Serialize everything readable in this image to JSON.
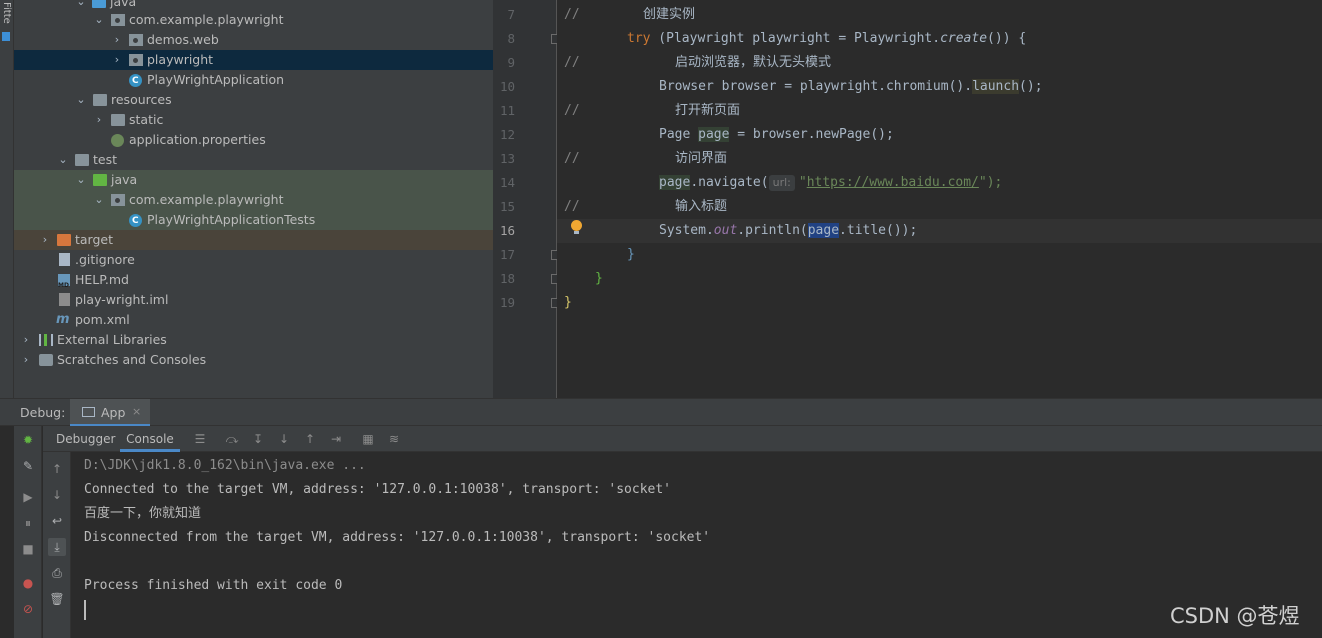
{
  "left_strip": {
    "vertical_tab_label": "Fitte"
  },
  "project_tree": {
    "rows": [
      {
        "label": "java",
        "icon": "source-folder-icon"
      },
      {
        "label": "com.example.playwright",
        "icon": "package-icon"
      },
      {
        "label": "demos.web",
        "icon": "package-icon"
      },
      {
        "label": "playwright",
        "icon": "package-icon",
        "selected": true
      },
      {
        "label": "PlayWrightApplication",
        "icon": "spring-class-icon"
      },
      {
        "label": "resources",
        "icon": "resources-folder-icon"
      },
      {
        "label": "static",
        "icon": "folder-icon"
      },
      {
        "label": "application.properties",
        "icon": "properties-file-icon"
      },
      {
        "label": "test",
        "icon": "folder-icon"
      },
      {
        "label": "java",
        "icon": "test-source-folder-icon"
      },
      {
        "label": "com.example.playwright",
        "icon": "package-icon"
      },
      {
        "label": "PlayWrightApplicationTests",
        "icon": "test-class-icon"
      },
      {
        "label": "target",
        "icon": "excluded-folder-icon"
      },
      {
        "label": ".gitignore",
        "icon": "gitignore-file-icon"
      },
      {
        "label": "HELP.md",
        "icon": "markdown-file-icon"
      },
      {
        "label": "play-wright.iml",
        "icon": "iml-file-icon"
      },
      {
        "label": "pom.xml",
        "icon": "maven-pom-icon"
      },
      {
        "label": "External Libraries",
        "icon": "libraries-icon"
      },
      {
        "label": "Scratches and Consoles",
        "icon": "scratches-icon"
      }
    ]
  },
  "editor": {
    "line_numbers": [
      "7",
      "8",
      "9",
      "10",
      "11",
      "12",
      "13",
      "14",
      "15",
      "16",
      "17",
      "18",
      "19"
    ],
    "current_line": "16",
    "code": {
      "l7_comment_marker": "//",
      "l7_comment_text": "创建实例",
      "l8_try": "try",
      "l8_rest": " (Playwright playwright = Playwright.",
      "l8_create": "create",
      "l8_tail": "()) {",
      "l9_comment_marker": "//",
      "l9_comment_text": "启动浏览器，默认无头模式",
      "l10_start": "Browser browser = playwright.chromium().",
      "l10_launch": "launch",
      "l10_end": "();",
      "l11_comment_marker": "//",
      "l11_comment_text": "打开新页面",
      "l12_start": "Page ",
      "l12_page": "page",
      "l12_end": " = browser.newPage();",
      "l13_comment_marker": "//",
      "l13_comment_text": "访问界面",
      "l14_start": "page",
      "l14_mid": ".navigate(",
      "l14_hint": "url:",
      "l14_quote_open": "\"",
      "l14_url": "https://www.baidu.com/",
      "l14_end": "\");",
      "l15_comment_marker": "//",
      "l15_comment_text": "输入标题",
      "l16_start": "System.",
      "l16_out": "out",
      "l16_mid": ".println(",
      "l16_page": "page",
      "l16_end": ".title());",
      "l17": "}",
      "l18": "}",
      "l19": "}"
    }
  },
  "debug_panel": {
    "title": "Debug:",
    "tab_label": "App",
    "tab_close": "×",
    "sub_tabs": [
      "Debugger",
      "Console"
    ],
    "active_sub_tab": "Console",
    "console_lines": [
      "D:\\JDK\\jdk1.8.0_162\\bin\\java.exe ...",
      "Connected to the target VM, address: '127.0.0.1:10038', transport: 'socket'",
      "百度一下，你就知道",
      "Disconnected from the target VM, address: '127.0.0.1:10038', transport: 'socket'",
      "",
      "Process finished with exit code 0"
    ]
  },
  "watermark": "CSDN @苍煜",
  "colors": {
    "keyword": "#cc7832",
    "string": "#6a8759",
    "comment": "#808080",
    "static_field": "#9876aa",
    "accent": "#4a88c7",
    "selection": "#0d293e"
  }
}
